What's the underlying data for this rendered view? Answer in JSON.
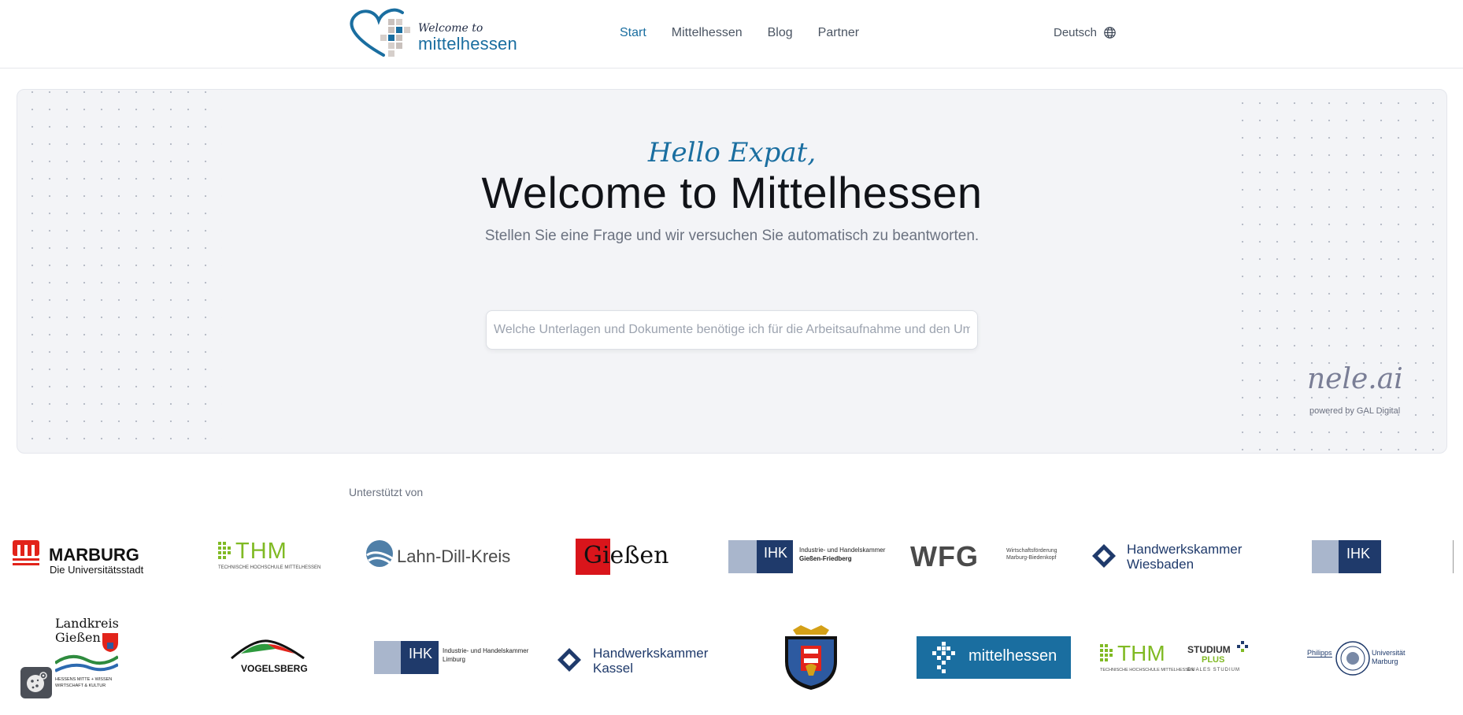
{
  "header": {
    "logo_small": "Welcome to",
    "logo_big": "mittelhessen",
    "nav": [
      {
        "label": "Start",
        "active": true
      },
      {
        "label": "Mittelhessen",
        "active": false
      },
      {
        "label": "Blog",
        "active": false
      },
      {
        "label": "Partner",
        "active": false
      }
    ],
    "language": "Deutsch",
    "language_icon": "globe-icon"
  },
  "hero": {
    "greeting": "Hello Expat,",
    "title": "Welcome to Mittelhessen",
    "subtitle": "Stellen Sie eine Frage und wir versuchen Sie automatisch zu beantworten.",
    "search_placeholder": "Welche Unterlagen und Dokumente benötige ich für die Arbeitsaufnahme und den Umzu",
    "brand_word": "nele.ai",
    "brand_powered": "powered by GAL Digital"
  },
  "supporters": {
    "heading": "Unterstützt von",
    "row1": {
      "marburg_title": "MARBURG",
      "marburg_sub": "Die Universitätsstadt",
      "thm": "THM",
      "thm_sub": "TECHNISCHE HOCHSCHULE MITTELHESSEN",
      "ldk": "Lahn-Dill-Kreis",
      "giessen": "Gießen",
      "ihk_gf": "IHK",
      "ihk_gf_text1": "Industrie- und Handelskammer",
      "ihk_gf_text2": "Gießen-Friedberg",
      "wfg": "WFG",
      "wfg_text1": "Wirtschaftsförderung",
      "wfg_text2": "Marburg-Biedenkopf",
      "hwk_wi1": "Handwerkskammer",
      "hwk_wi2": "Wiesbaden",
      "ihk2": "IHK"
    },
    "row2": {
      "lkg1": "Landkreis",
      "lkg2": "Gießen",
      "lkg3": "HESSENS MITTE + WISSEN",
      "lkg4": "WIRTSCHAFT & KULTUR",
      "vogelsberg": "VOGELSBERG",
      "ihk_li": "IHK",
      "ihk_li_text1": "Industrie- und Handelskammer",
      "ihk_li_text2": "Limburg",
      "hwk_ks1": "Handwerkskammer",
      "hwk_ks2": "Kassel",
      "mittelhessen": "mittelhessen",
      "thm": "THM",
      "thm_sub": "TECHNISCHE HOCHSCHULE MITTELHESSEN",
      "studium1": "STUDIUM",
      "studium2": "PLUS",
      "studium3": "DUALES STUDIUM",
      "pum1": "Philipps",
      "pum2": "Universität",
      "pum3": "Marburg"
    }
  },
  "colors": {
    "brand_blue": "#1a6ea0",
    "hero_bg": "#f3f4f7",
    "thm_green": "#80ba24",
    "ihk_navy": "#1f3a6b"
  },
  "cookie_icon": "cookie-settings-icon"
}
